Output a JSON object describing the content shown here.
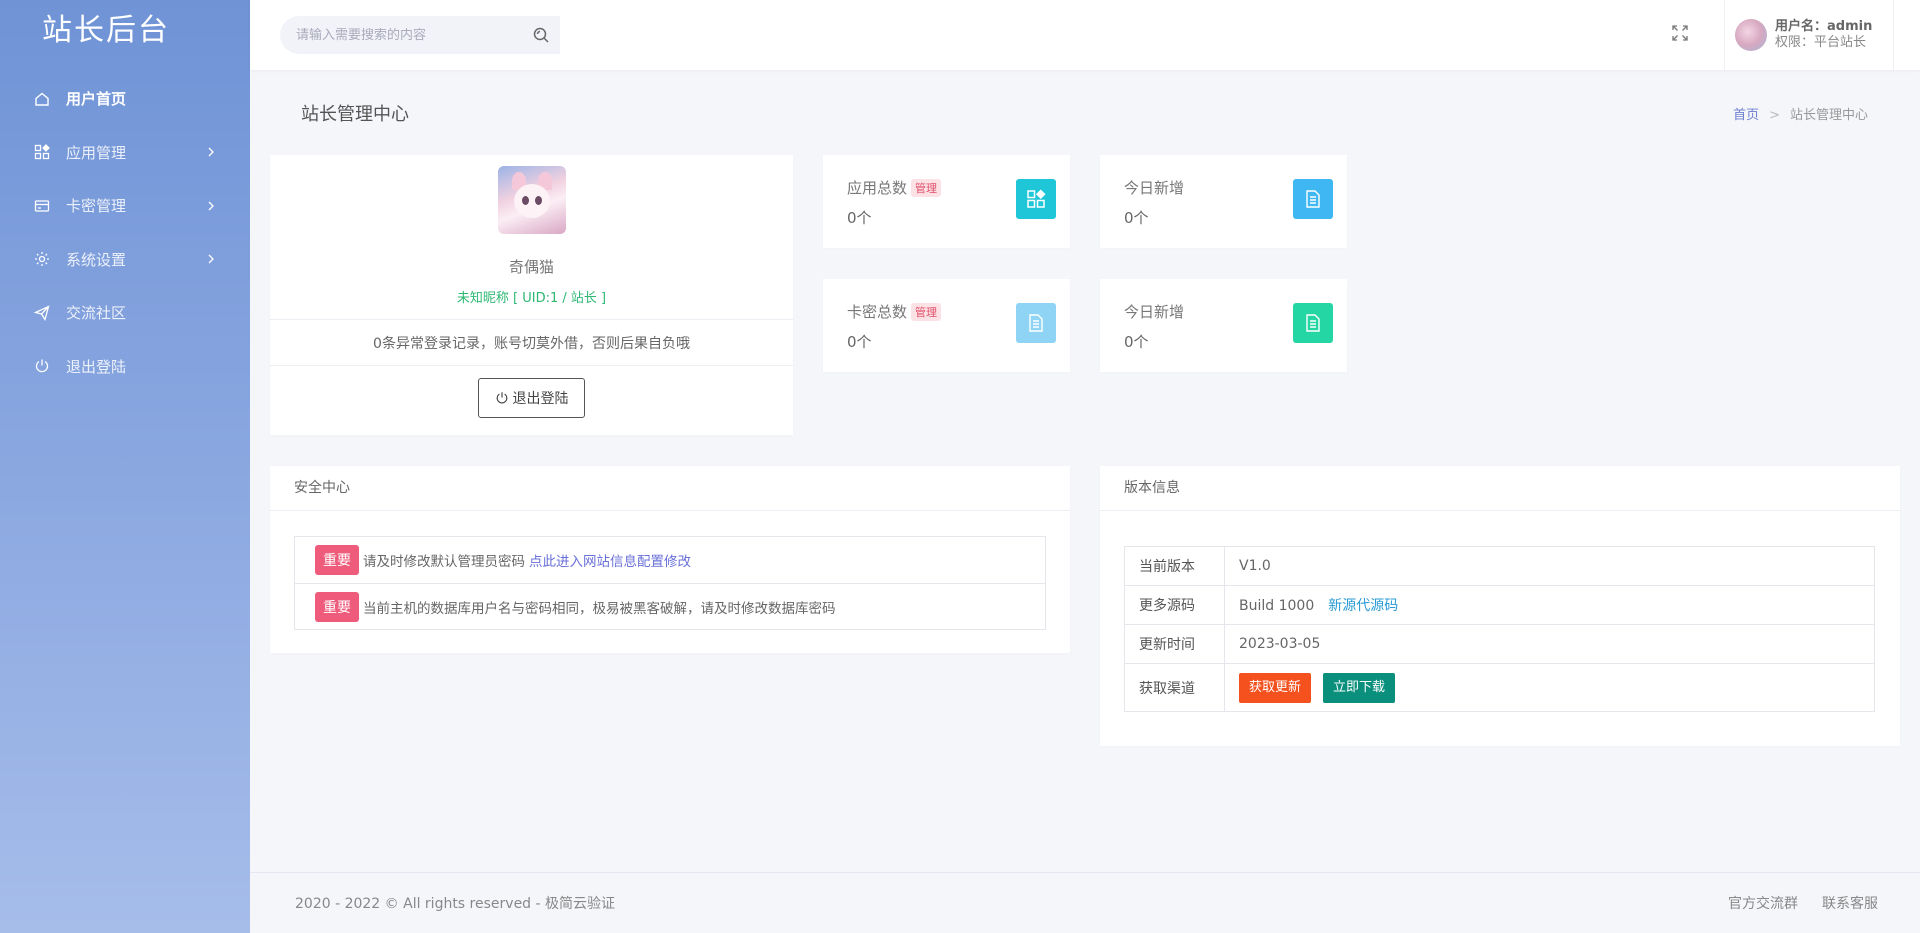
{
  "sidebar": {
    "brand": "站长后台",
    "items": [
      {
        "label": "用户首页",
        "icon": "home-icon",
        "active": true
      },
      {
        "label": "应用管理",
        "icon": "apps-icon",
        "has_children": true
      },
      {
        "label": "卡密管理",
        "icon": "card-icon",
        "has_children": true
      },
      {
        "label": "系统设置",
        "icon": "gear-icon",
        "has_children": true
      },
      {
        "label": "交流社区",
        "icon": "paper-plane-icon"
      },
      {
        "label": "退出登陆",
        "icon": "power-icon"
      }
    ]
  },
  "header": {
    "search_placeholder": "请输入需要搜索的内容",
    "user_name_label": "用户名：admin",
    "user_role_label": "权限：平台站长"
  },
  "page": {
    "title": "站长管理中心",
    "breadcrumb": {
      "home": "首页",
      "current": "站长管理中心"
    }
  },
  "profile": {
    "name": "奇偶猫",
    "uid_line": "未知昵称 [ UID:1 / 站长 ]",
    "warning": "0条异常登录记录，账号切莫外借，否则后果自负哦",
    "logout_label": "退出登陆"
  },
  "stats": [
    {
      "label": "应用总数",
      "badge": "管理",
      "value": "0个",
      "color": "#1ec6d8",
      "icon": "apps-icon"
    },
    {
      "label": "今日新增",
      "value": "0个",
      "color": "#3fb7f2",
      "icon": "document-icon"
    },
    {
      "label": "卡密总数",
      "badge": "管理",
      "value": "0个",
      "color": "#8fd4f4",
      "icon": "document-icon"
    },
    {
      "label": "今日新增",
      "value": "0个",
      "color": "#24d6a3",
      "icon": "document-icon"
    }
  ],
  "security": {
    "title": "安全中心",
    "rows": [
      {
        "tag": "重要",
        "text": "请及时修改默认管理员密码",
        "link": "点此进入网站信息配置修改"
      },
      {
        "tag": "重要",
        "text": "当前主机的数据库用户名与密码相同，极易被黑客破解，请及时修改数据库密码"
      }
    ]
  },
  "version": {
    "title": "版本信息",
    "rows": [
      {
        "key": "当前版本",
        "value": "V1.0"
      },
      {
        "key": "更多源码",
        "value": "Build 1000",
        "link": "新源代源码"
      },
      {
        "key": "更新时间",
        "value": "2023-03-05"
      },
      {
        "key": "获取渠道",
        "buttons": [
          {
            "label": "获取更新",
            "color": "#f4511e"
          },
          {
            "label": "立即下载",
            "color": "#0a8f7d"
          }
        ]
      }
    ]
  },
  "footer": {
    "copyright": "2020 - 2022 © All rights reserved - 极简云验证",
    "links": [
      "官方交流群",
      "联系客服"
    ]
  }
}
